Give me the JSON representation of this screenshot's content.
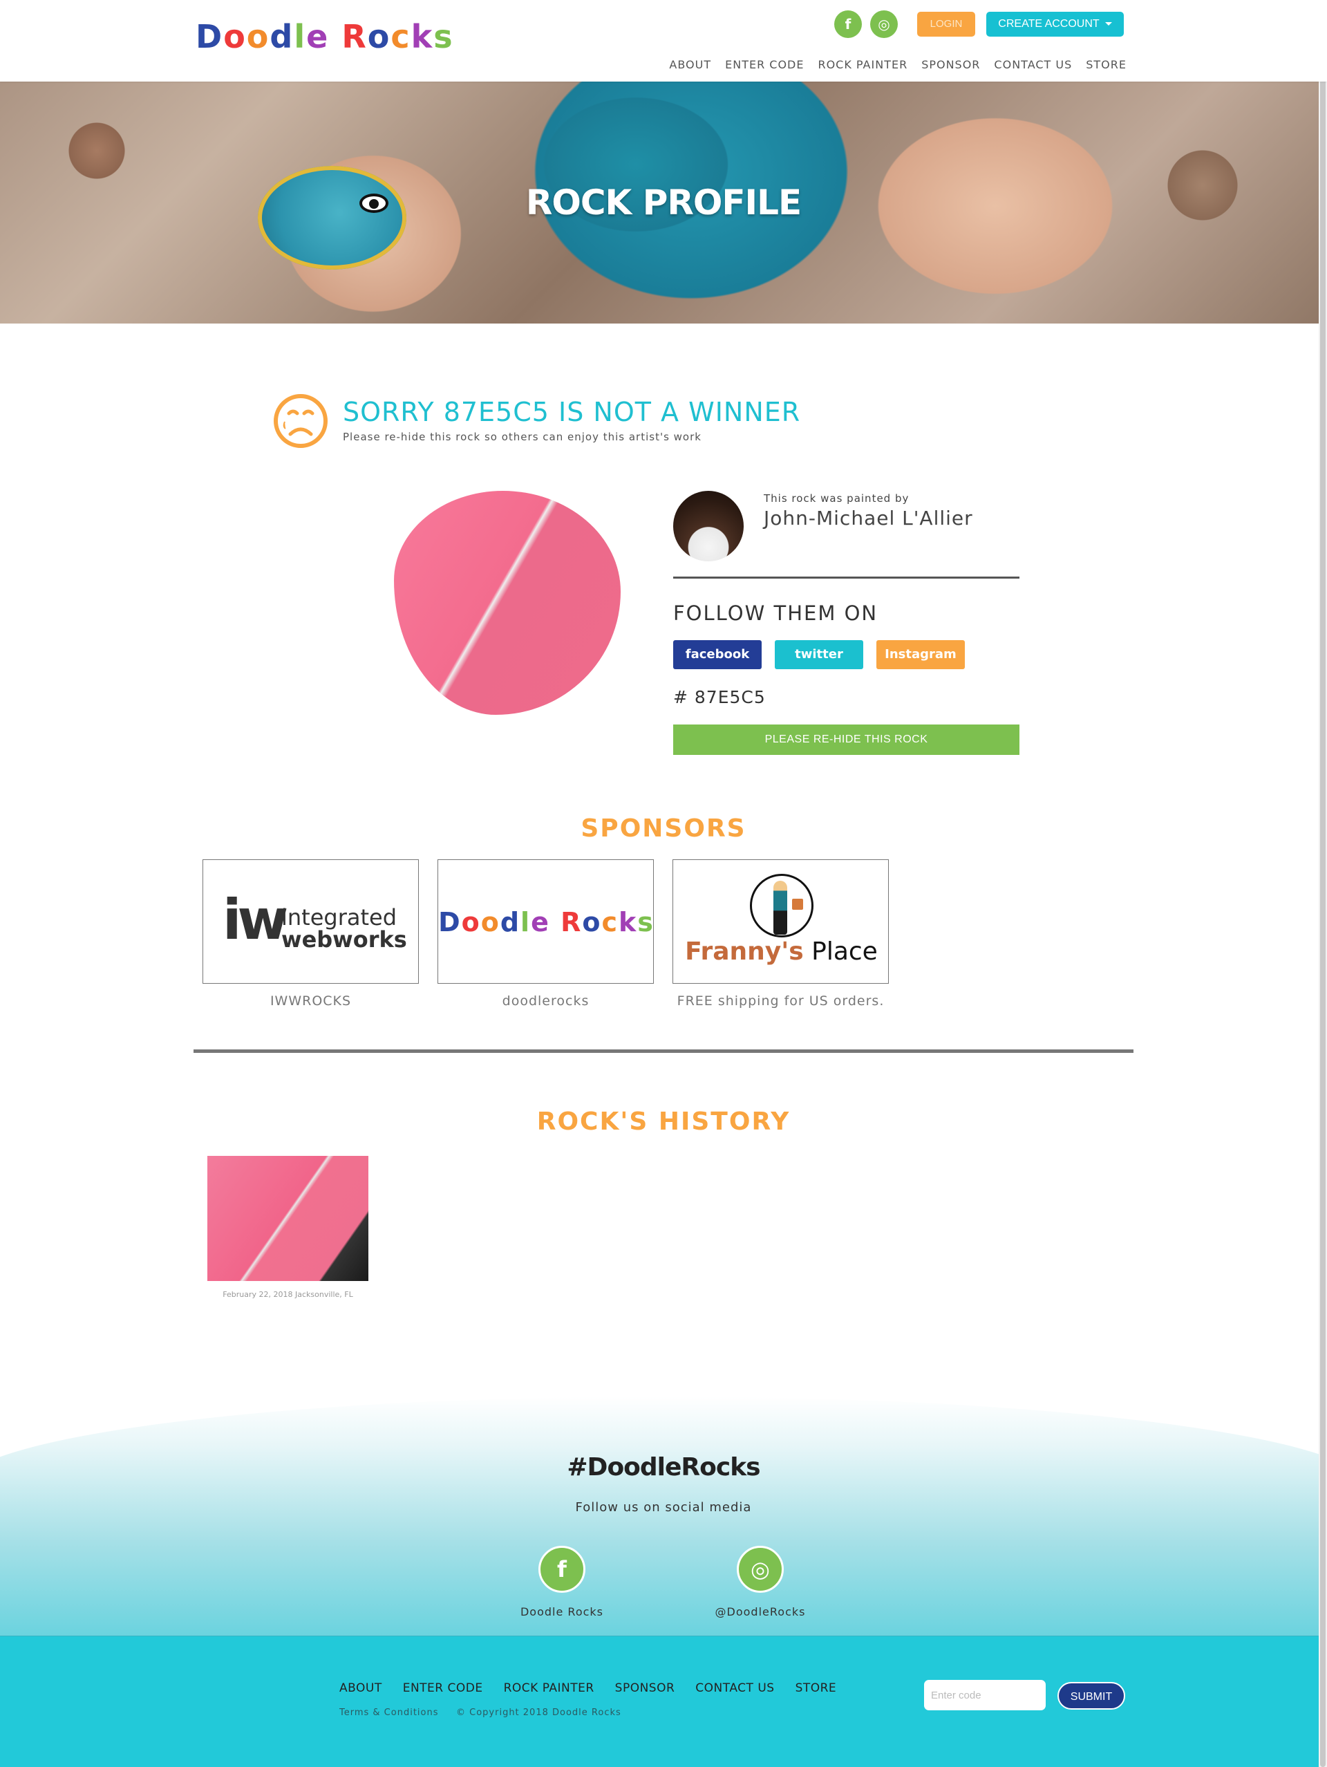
{
  "header": {
    "logo_text": "Doodle Rocks",
    "logo_letters": [
      {
        "ch": "D",
        "color": "#2d4aa6"
      },
      {
        "ch": "o",
        "color": "#ee3a3a"
      },
      {
        "ch": "o",
        "color": "#f28b2b"
      },
      {
        "ch": "d",
        "color": "#2d4aa6"
      },
      {
        "ch": "l",
        "color": "#7dc04f"
      },
      {
        "ch": "e",
        "color": "#a13fb5"
      },
      {
        "ch": " ",
        "color": "#000000"
      },
      {
        "ch": "R",
        "color": "#ee3a3a"
      },
      {
        "ch": "o",
        "color": "#2d4aa6"
      },
      {
        "ch": "c",
        "color": "#f28b2b"
      },
      {
        "ch": "k",
        "color": "#a13fb5"
      },
      {
        "ch": "s",
        "color": "#7dc04f"
      }
    ],
    "social_facebook_icon": "facebook-icon",
    "social_instagram_icon": "instagram-icon",
    "facebook_glyph": "f",
    "instagram_glyph": "◎",
    "login_label": "LOGIN",
    "create_account_label": "CREATE ACCOUNT",
    "nav": [
      "ABOUT",
      "ENTER CODE",
      "ROCK PAINTER",
      "SPONSOR",
      "CONTACT US",
      "STORE"
    ]
  },
  "hero": {
    "title": "ROCK PROFILE"
  },
  "result": {
    "title": "SORRY 87E5C5 IS NOT A WINNER",
    "subtitle": "Please re-hide this rock so others can enjoy this artist's work"
  },
  "rock": {
    "painted_by_label": "This rock was painted by",
    "painter_name": "John-Michael L'Allier",
    "follow_title": "FOLLOW THEM ON",
    "social_buttons": [
      {
        "label": "facebook",
        "color": "#233d96"
      },
      {
        "label": "twitter",
        "color": "#1bc0cf"
      },
      {
        "label": "Instagram",
        "color": "#f9a541"
      }
    ],
    "code": "# 87E5C5",
    "rehide_label": "PLEASE RE-HIDE THIS ROCK"
  },
  "sponsors": {
    "title": "SPONSORS",
    "items": [
      {
        "name": "integrated webworks",
        "line1": "integrated",
        "line2": "webworks",
        "mark": "iw",
        "caption": "IWWROCKS"
      },
      {
        "name": "Doodle Rocks",
        "caption": "doodlerocks"
      },
      {
        "name": "Franny's Place",
        "part1": "Franny's",
        "part2": " Place",
        "caption": "FREE shipping for US orders."
      }
    ]
  },
  "history": {
    "title": "ROCK'S HISTORY",
    "entries": [
      {
        "caption": "February 22, 2018 Jacksonville, FL"
      }
    ]
  },
  "footer": {
    "hashtag": "#DoodleRocks",
    "follow_text": "Follow us on social media",
    "facebook_label": "Doodle Rocks",
    "instagram_label": "@DoodleRocks",
    "facebook_glyph": "f",
    "instagram_glyph": "◎",
    "nav": [
      "ABOUT",
      "ENTER CODE",
      "ROCK PAINTER",
      "SPONSOR",
      "CONTACT US",
      "STORE"
    ],
    "terms": "Terms & Conditions",
    "copyright": "© Copyright 2018 Doodle Rocks",
    "code_placeholder": "Enter code",
    "submit_label": "SUBMIT"
  }
}
